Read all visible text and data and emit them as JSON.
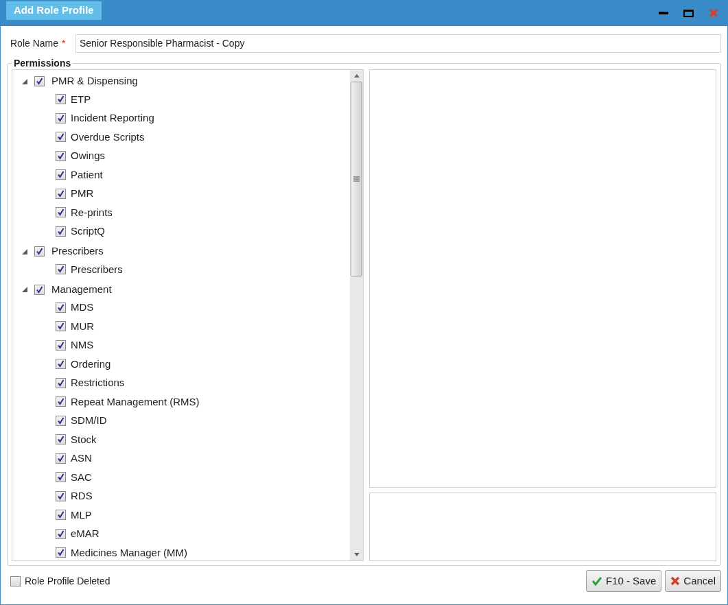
{
  "window": {
    "title": "Add Role Profile"
  },
  "role_name": {
    "label": "Role Name",
    "required_mark": "*",
    "value": "Senior Responsible Pharmacist - Copy"
  },
  "permissions": {
    "title": "Permissions",
    "groups": [
      {
        "label": "PMR & Dispensing",
        "expanded": true,
        "checked": true,
        "children": [
          {
            "label": "ETP",
            "checked": true
          },
          {
            "label": "Incident Reporting",
            "checked": true
          },
          {
            "label": "Overdue Scripts",
            "checked": true
          },
          {
            "label": "Owings",
            "checked": true
          },
          {
            "label": "Patient",
            "checked": true
          },
          {
            "label": "PMR",
            "checked": true
          },
          {
            "label": "Re-prints",
            "checked": true
          },
          {
            "label": "ScriptQ",
            "checked": true
          }
        ]
      },
      {
        "label": "Prescribers",
        "expanded": true,
        "checked": true,
        "children": [
          {
            "label": "Prescribers",
            "checked": true
          }
        ]
      },
      {
        "label": "Management",
        "expanded": true,
        "checked": true,
        "children": [
          {
            "label": "MDS",
            "checked": true
          },
          {
            "label": "MUR",
            "checked": true
          },
          {
            "label": "NMS",
            "checked": true
          },
          {
            "label": "Ordering",
            "checked": true
          },
          {
            "label": "Restrictions",
            "checked": true
          },
          {
            "label": "Repeat Management (RMS)",
            "checked": true
          },
          {
            "label": "SDM/ID",
            "checked": true
          },
          {
            "label": "Stock",
            "checked": true
          },
          {
            "label": "ASN",
            "checked": true
          },
          {
            "label": "SAC",
            "checked": true
          },
          {
            "label": "RDS",
            "checked": true
          },
          {
            "label": "MLP",
            "checked": true
          },
          {
            "label": "eMAR",
            "checked": true
          },
          {
            "label": "Medicines Manager (MM)",
            "checked": true
          }
        ]
      }
    ]
  },
  "deleted": {
    "label": "Role Profile Deleted",
    "checked": false
  },
  "buttons": [
    {
      "kind": "save",
      "label": "F10 - Save"
    },
    {
      "kind": "cancel",
      "label": "Cancel"
    }
  ]
}
